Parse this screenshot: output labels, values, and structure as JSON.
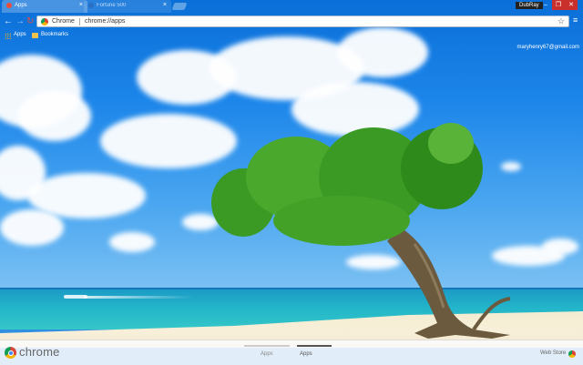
{
  "tabs": [
    {
      "label": "Apps",
      "active": true
    },
    {
      "label": "Fortune 500",
      "active": false
    }
  ],
  "profile": {
    "label": "DubRay"
  },
  "toolbar": {
    "omnibox_chip": "Chrome",
    "url": "chrome://apps"
  },
  "bookmarks": {
    "apps_label": "Apps",
    "bookmarks_label": "Bookmarks"
  },
  "account": {
    "email": "maryhenry67@gmail.com"
  },
  "bottom": {
    "brand": "chrome",
    "pages": [
      "Apps",
      "Apps"
    ],
    "webstore": "Web Store"
  },
  "colors": {
    "sky": "#1d86ea",
    "sea": "#22b4c9",
    "sand": "#f4ecd0",
    "foliage": "#3a9a24",
    "bottombar": "#fafafa"
  },
  "icons": [
    "back-icon",
    "forward-icon",
    "reload-icon",
    "star-icon",
    "menu-icon",
    "apps-grid-icon",
    "folder-icon",
    "chrome-logo-icon",
    "webstore-icon",
    "left-arrow-icon"
  ]
}
